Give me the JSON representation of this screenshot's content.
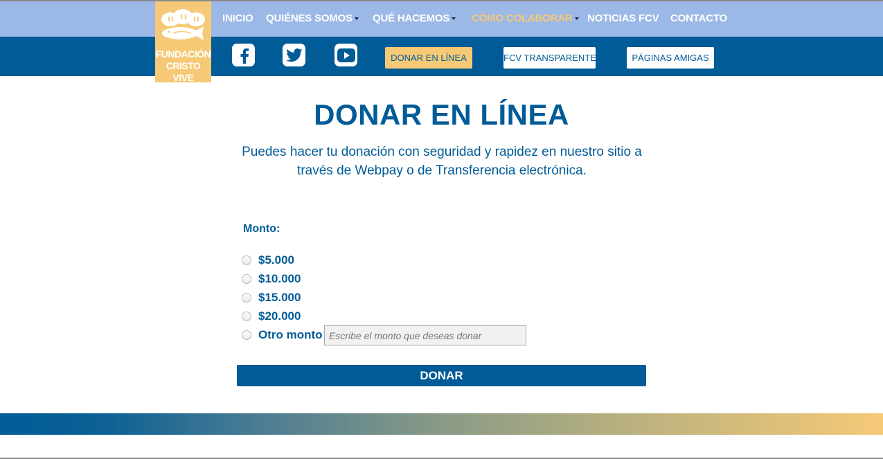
{
  "brand": {
    "logo_text_line1": "FUNDACIÓN",
    "logo_text_line2": "CRISTO VIVE",
    "logo_color": "#f6c977"
  },
  "nav": {
    "items": [
      {
        "label": "INICIO",
        "dropdown": false,
        "active": false
      },
      {
        "label": "QUIÉNES SOMOS",
        "dropdown": true,
        "active": false
      },
      {
        "label": "QUÉ HACEMOS",
        "dropdown": true,
        "active": false
      },
      {
        "label": "CÓMO COLABORAR",
        "dropdown": true,
        "active": true
      },
      {
        "label": "NOTICIAS FCV",
        "dropdown": false,
        "active": false
      },
      {
        "label": "CONTACTO",
        "dropdown": false,
        "active": false
      }
    ],
    "social": [
      {
        "icon": "facebook-icon"
      },
      {
        "icon": "twitter-icon"
      },
      {
        "icon": "youtube-icon"
      }
    ],
    "buttons": [
      {
        "label": "DONAR EN LÍNEA",
        "style": "highlighted"
      },
      {
        "label": "FCV TRANSPARENTE",
        "style": "outline"
      },
      {
        "label": "PÁGINAS AMIGAS",
        "style": "outline"
      }
    ]
  },
  "main": {
    "title": "DONAR EN LÍNEA",
    "subtitle": "Puedes hacer tu donación con seguridad y rapidez en nuestro sitio a través de Webpay o de Transferencia electrónica.",
    "monto_label": "Monto:",
    "options": [
      "$5.000",
      "$10.000",
      "$15.000",
      "$20.000",
      "Otro monto"
    ],
    "other_amount": {
      "value": "",
      "placeholder": "Escribe el monto que deseas donar"
    },
    "submit_label": "DONAR"
  },
  "colors": {
    "primary_blue": "#005b96",
    "light_blue": "#9bb8e6",
    "gold": "#f6c977"
  }
}
